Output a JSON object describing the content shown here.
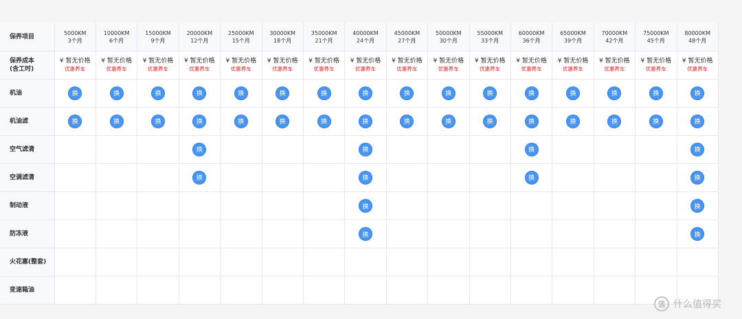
{
  "table": {
    "header_label": "保养项目",
    "cost_label_line1": "保养成本",
    "cost_label_line2": "(含工时)",
    "intervals": [
      {
        "km": "5000KM",
        "months": "3个月"
      },
      {
        "km": "10000KM",
        "months": "6个月"
      },
      {
        "km": "15000KM",
        "months": "9个月"
      },
      {
        "km": "20000KM",
        "months": "12个月"
      },
      {
        "km": "25000KM",
        "months": "15个月"
      },
      {
        "km": "30000KM",
        "months": "18个月"
      },
      {
        "km": "35000KM",
        "months": "21个月"
      },
      {
        "km": "40000KM",
        "months": "24个月"
      },
      {
        "km": "45000KM",
        "months": "27个月"
      },
      {
        "km": "50000KM",
        "months": "30个月"
      },
      {
        "km": "55000KM",
        "months": "33个月"
      },
      {
        "km": "60000KM",
        "months": "36个月"
      },
      {
        "km": "65000KM",
        "months": "39个月"
      },
      {
        "km": "70000KM",
        "months": "42个月"
      },
      {
        "km": "75000KM",
        "months": "45个月"
      },
      {
        "km": "80000KM",
        "months": "48个月"
      }
    ],
    "price_text": "¥ 暂无价格",
    "price_link": "优惠养车",
    "replace_label": "换",
    "items": [
      {
        "name": "机油",
        "replace_at": [
          0,
          1,
          2,
          3,
          4,
          5,
          6,
          7,
          8,
          9,
          10,
          11,
          12,
          13,
          14,
          15
        ]
      },
      {
        "name": "机油滤",
        "replace_at": [
          0,
          1,
          2,
          3,
          4,
          5,
          6,
          7,
          8,
          9,
          10,
          11,
          12,
          13,
          14,
          15
        ]
      },
      {
        "name": "空气滤清",
        "replace_at": [
          3,
          7,
          11,
          15
        ]
      },
      {
        "name": "空调滤清",
        "replace_at": [
          3,
          7,
          11,
          15
        ]
      },
      {
        "name": "制动液",
        "replace_at": [
          7,
          15
        ]
      },
      {
        "name": "防冻液",
        "replace_at": [
          7,
          15
        ]
      },
      {
        "name": "火花塞(整套)",
        "replace_at": []
      },
      {
        "name": "变速箱油",
        "replace_at": []
      }
    ]
  },
  "colors": {
    "badge": "#4a94f2",
    "price_link": "#e02020",
    "grid": "#e6e8eb",
    "header_bg": "#f8f9fb"
  },
  "watermark": {
    "icon": "zhi-logo-icon",
    "glyph": "值",
    "text": "什么值得买"
  }
}
